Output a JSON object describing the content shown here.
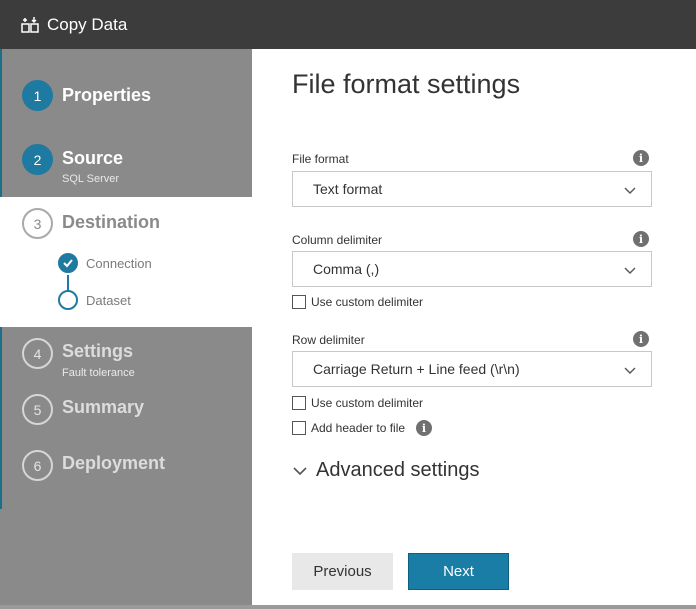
{
  "window": {
    "title": "Copy Data",
    "icon": "copy-data-icon"
  },
  "sidebar": {
    "steps": [
      {
        "number": "1",
        "label": "Properties",
        "sub": "",
        "state": "done"
      },
      {
        "number": "2",
        "label": "Source",
        "sub": "SQL Server",
        "state": "done"
      },
      {
        "number": "3",
        "label": "Destination",
        "sub": "",
        "state": "current",
        "substeps": [
          {
            "label": "Connection",
            "state": "checked"
          },
          {
            "label": "Dataset",
            "state": "current"
          }
        ]
      },
      {
        "number": "4",
        "label": "Settings",
        "sub": "Fault tolerance",
        "state": "inactive"
      },
      {
        "number": "5",
        "label": "Summary",
        "sub": "",
        "state": "inactive"
      },
      {
        "number": "6",
        "label": "Deployment",
        "sub": "",
        "state": "inactive"
      }
    ]
  },
  "main": {
    "heading": "File format settings",
    "file_format": {
      "label": "File format",
      "value": "Text format"
    },
    "column_delimiter": {
      "label": "Column delimiter",
      "value": "Comma (,)",
      "custom_label": "Use custom delimiter"
    },
    "row_delimiter": {
      "label": "Row delimiter",
      "value": "Carriage Return + Line feed (\\r\\n)",
      "custom_label": "Use custom delimiter"
    },
    "add_header": {
      "label": "Add header to file"
    },
    "advanced": {
      "label": "Advanced settings"
    },
    "buttons": {
      "previous": "Previous",
      "next": "Next"
    }
  },
  "colors": {
    "accent": "#1e7aa0",
    "sidebar": "#8a8a8a",
    "titlebar": "#3c3c3c"
  }
}
